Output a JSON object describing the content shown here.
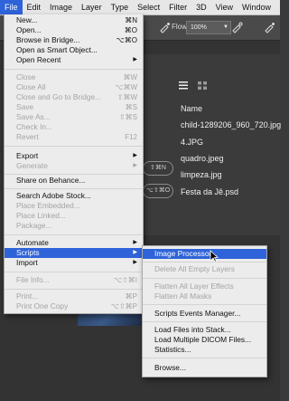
{
  "menubar": {
    "items": [
      "File",
      "Edit",
      "Image",
      "Layer",
      "Type",
      "Select",
      "Filter",
      "3D",
      "View",
      "Window"
    ]
  },
  "options_bar": {
    "flow_label": "Flow:",
    "flow_value": "100%"
  },
  "workspace": {
    "name_header": "Name",
    "files": [
      "child-1289206_960_720.jpg",
      "4.JPG",
      "quadro.jpeg",
      "limpeza.jpg",
      "Festa da Jê.psd"
    ],
    "pill_1": "⇧⌘N",
    "pill_2": "⌥⇧⌘O"
  },
  "file_menu": {
    "items": [
      {
        "label": "New...",
        "shortcut": "⌘N"
      },
      {
        "label": "Open...",
        "shortcut": "⌘O"
      },
      {
        "label": "Browse in Bridge...",
        "shortcut": "⌥⌘O"
      },
      {
        "label": "Open as Smart Object..."
      },
      {
        "label": "Open Recent",
        "submenu": true
      },
      {
        "label": "Close",
        "shortcut": "⌘W",
        "disabled": true
      },
      {
        "label": "Close All",
        "shortcut": "⌥⌘W",
        "disabled": true
      },
      {
        "label": "Close and Go to Bridge...",
        "shortcut": "⇧⌘W",
        "disabled": true
      },
      {
        "label": "Save",
        "shortcut": "⌘S",
        "disabled": true
      },
      {
        "label": "Save As...",
        "shortcut": "⇧⌘S",
        "disabled": true
      },
      {
        "label": "Check In...",
        "disabled": true
      },
      {
        "label": "Revert",
        "shortcut": "F12",
        "disabled": true
      },
      {
        "label": "Export",
        "submenu": true
      },
      {
        "label": "Generate",
        "submenu": true,
        "disabled": true
      },
      {
        "label": "Share on Behance..."
      },
      {
        "label": "Search Adobe Stock..."
      },
      {
        "label": "Place Embedded...",
        "disabled": true
      },
      {
        "label": "Place Linked...",
        "disabled": true
      },
      {
        "label": "Package...",
        "disabled": true
      },
      {
        "label": "Automate",
        "submenu": true
      },
      {
        "label": "Scripts",
        "submenu": true,
        "highlighted": true
      },
      {
        "label": "Import",
        "submenu": true
      },
      {
        "label": "File Info...",
        "shortcut": "⌥⇧⌘I",
        "disabled": true
      },
      {
        "label": "Print...",
        "shortcut": "⌘P",
        "disabled": true
      },
      {
        "label": "Print One Copy",
        "shortcut": "⌥⇧⌘P",
        "disabled": true
      }
    ]
  },
  "scripts_submenu": {
    "items": [
      {
        "label": "Image Processor...",
        "highlighted": true
      },
      {
        "label": "Delete All Empty Layers",
        "disabled": true
      },
      {
        "label": "Flatten All Layer Effects",
        "disabled": true
      },
      {
        "label": "Flatten All Masks",
        "disabled": true
      },
      {
        "label": "Scripts Events Manager..."
      },
      {
        "label": "Load Files into Stack..."
      },
      {
        "label": "Load Multiple DICOM Files..."
      },
      {
        "label": "Statistics..."
      },
      {
        "label": "Browse..."
      }
    ]
  },
  "colors": {
    "highlight": "#2f63d9",
    "menu_bg": "#ececec",
    "disabled_text": "#a4a4a4"
  }
}
